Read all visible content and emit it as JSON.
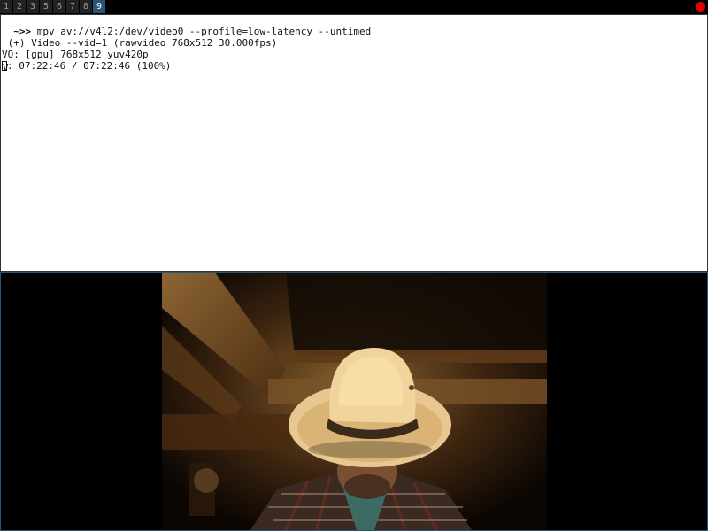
{
  "workspaces": [
    "1",
    "2",
    "3",
    "5",
    "6",
    "7",
    "8",
    "9"
  ],
  "active_workspace": "9",
  "colors": {
    "active_workspace_bg": "#285577",
    "inactive_workspace_bg": "#222222",
    "tray_indicator": "#e20000",
    "terminal_bg": "#ffffff",
    "focus_border": "#285577"
  },
  "terminal": {
    "prompt": "~>>",
    "command": "mpv av://v4l2:/dev/video0 --profile=low-latency --untimed",
    "lines": [
      " (+) Video --vid=1 (rawvideo 768x512 30.000fps)",
      "VO: [gpu] 768x512 yuv420p"
    ],
    "status_prefix": "V",
    "status_rest": ": 07:22:46 / 07:22:46 (100%)"
  },
  "video": {
    "resolution": "768x512",
    "subject": "person wearing a wide-brimmed hat in a dimly lit room"
  },
  "icons": {
    "tray": "record-indicator-icon"
  }
}
